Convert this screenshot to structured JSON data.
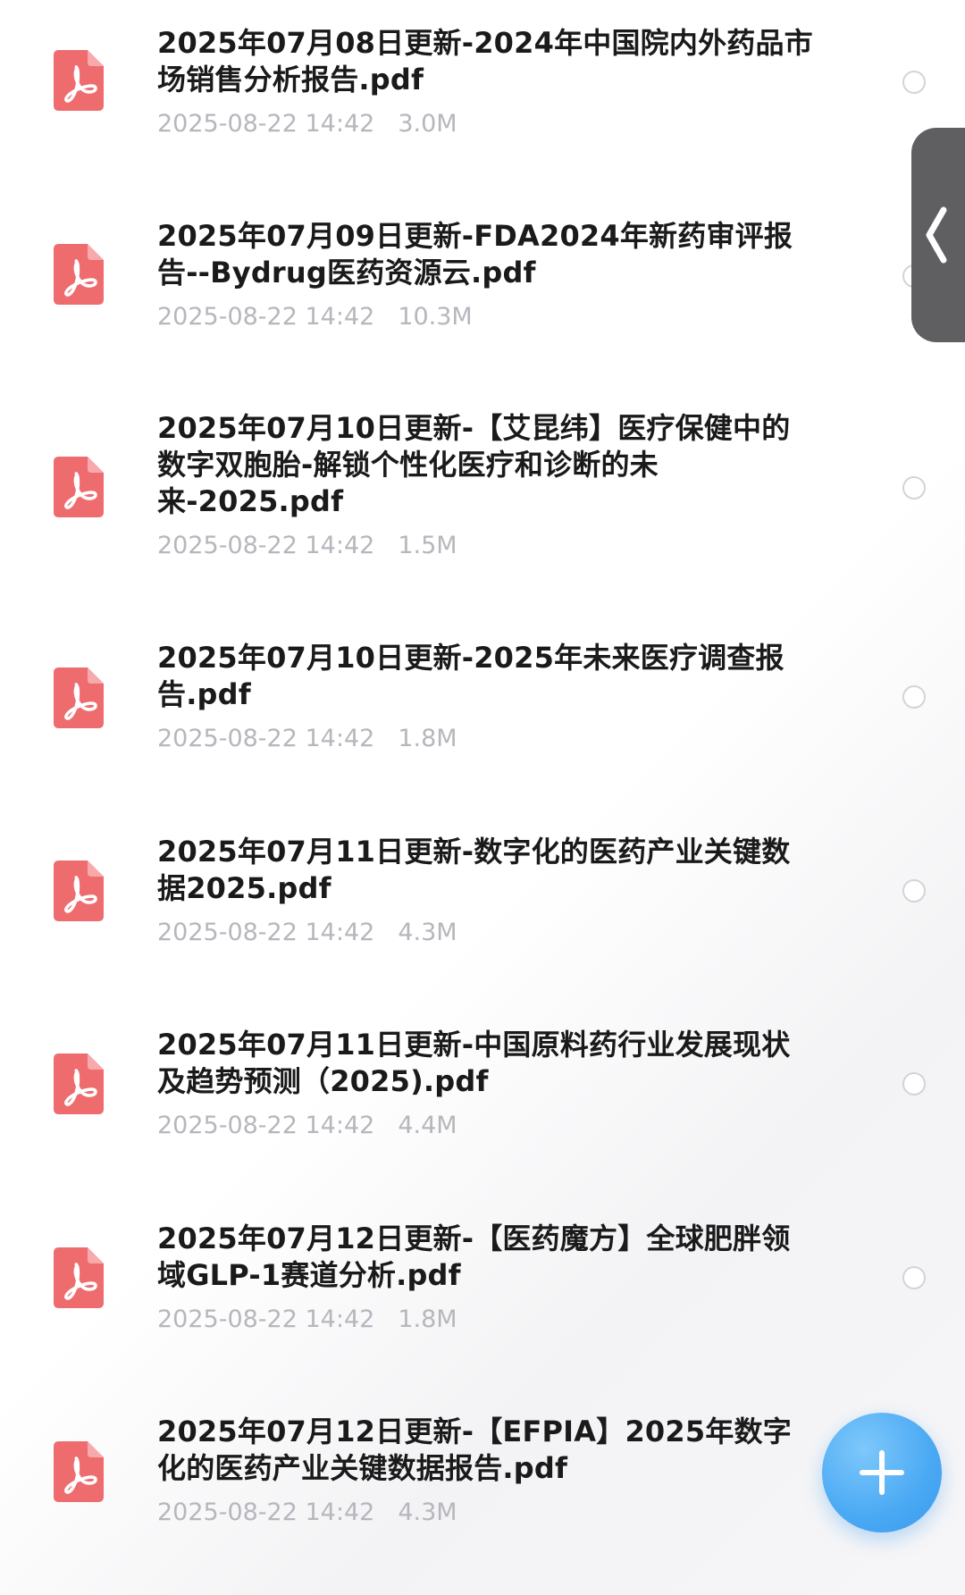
{
  "files": [
    {
      "name": "2025年07月08日更新-2024年中国院内外药品市场销售分析报告.pdf",
      "date": "2025-08-22 14:42",
      "size": "3.0M",
      "type_icon": "pdf-icon"
    },
    {
      "name": "2025年07月09日更新-FDA2024年新药审评报告--Bydrug医药资源云.pdf",
      "date": "2025-08-22 14:42",
      "size": "10.3M",
      "type_icon": "pdf-icon"
    },
    {
      "name": "2025年07月10日更新-【艾昆纬】医疗保健中的数字双胞胎-解锁个性化医疗和诊断的未来-2025.pdf",
      "date": "2025-08-22 14:42",
      "size": "1.5M",
      "type_icon": "pdf-icon"
    },
    {
      "name": "2025年07月10日更新-2025年未来医疗调查报告.pdf",
      "date": "2025-08-22 14:42",
      "size": "1.8M",
      "type_icon": "pdf-icon"
    },
    {
      "name": "2025年07月11日更新-数字化的医药产业关键数据2025.pdf",
      "date": "2025-08-22 14:42",
      "size": "4.3M",
      "type_icon": "pdf-icon"
    },
    {
      "name": "2025年07月11日更新-中国原料药行业发展现状及趋势预测（2025).pdf",
      "date": "2025-08-22 14:42",
      "size": "4.4M",
      "type_icon": "pdf-icon"
    },
    {
      "name": "2025年07月12日更新-【医药魔方】全球肥胖领域GLP-1赛道分析.pdf",
      "date": "2025-08-22 14:42",
      "size": "1.8M",
      "type_icon": "pdf-icon"
    },
    {
      "name": "2025年07月12日更新-【EFPIA】2025年数字化的医药产业关键数据报告.pdf",
      "date": "2025-08-22 14:42",
      "size": "4.3M",
      "type_icon": "pdf-icon"
    }
  ],
  "side_handle": {
    "icon": "chevron-left-icon"
  },
  "fab": {
    "icon": "plus-icon"
  },
  "colors": {
    "pdf_icon": "#ee6b6e",
    "title_text": "#1a1a1a",
    "meta_text": "#b6b6bd",
    "radio_border": "#d4d4d8",
    "side_handle": "#5f5f62",
    "fab": "#4aa9f3"
  }
}
